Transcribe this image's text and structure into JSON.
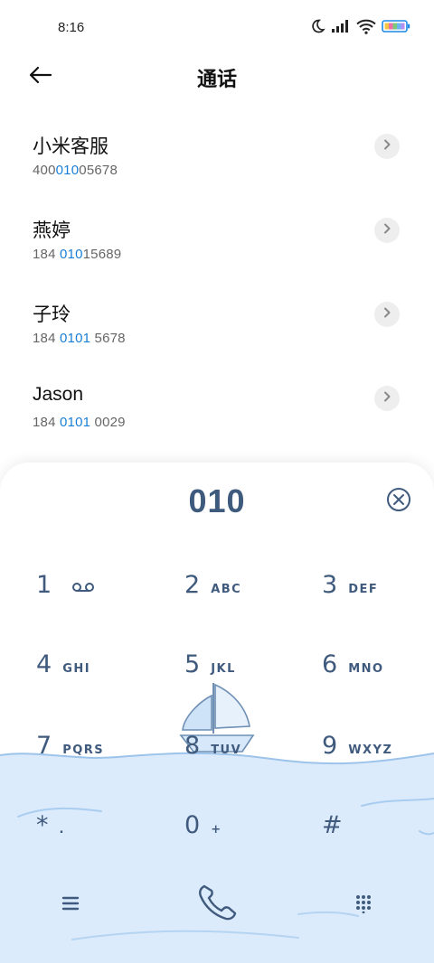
{
  "status_bar": {
    "time": "8:16",
    "icons": [
      "moon-icon",
      "signal-icon",
      "wifi-icon",
      "battery-icon"
    ]
  },
  "header": {
    "title": "通话",
    "back_icon": "back-arrow-icon"
  },
  "contacts": [
    {
      "name": "小米客服",
      "number_pre": "400",
      "number_match": "010",
      "number_post": "05678"
    },
    {
      "name": "燕婷",
      "number_pre": "184 ",
      "number_match": "010",
      "number_post": "15689"
    },
    {
      "name": "子玲",
      "number_pre": "184 ",
      "number_match": "0101",
      "number_post": " 5678"
    },
    {
      "name": "Jason",
      "number_pre": "184 ",
      "number_match": "0101",
      "number_post": " 0029"
    }
  ],
  "dialer": {
    "input_value": "010",
    "keys": [
      {
        "num": "1",
        "letters": ""
      },
      {
        "num": "2",
        "letters": "ABC"
      },
      {
        "num": "3",
        "letters": "DEF"
      },
      {
        "num": "4",
        "letters": "GHI"
      },
      {
        "num": "5",
        "letters": "JKL"
      },
      {
        "num": "6",
        "letters": "MNO"
      },
      {
        "num": "7",
        "letters": "PQRS"
      },
      {
        "num": "8",
        "letters": "TUV"
      },
      {
        "num": "9",
        "letters": "WXYZ"
      },
      {
        "num": "*",
        "letters": "."
      },
      {
        "num": "0",
        "letters": "+"
      },
      {
        "num": "#",
        "letters": ""
      }
    ],
    "bottom_icons": [
      "menu-icon",
      "call-icon",
      "keypad-icon"
    ]
  },
  "colors": {
    "accent_blue": "#1a7fd6",
    "dialer_text": "#3f5a7d",
    "sea": "#dcebfb"
  }
}
